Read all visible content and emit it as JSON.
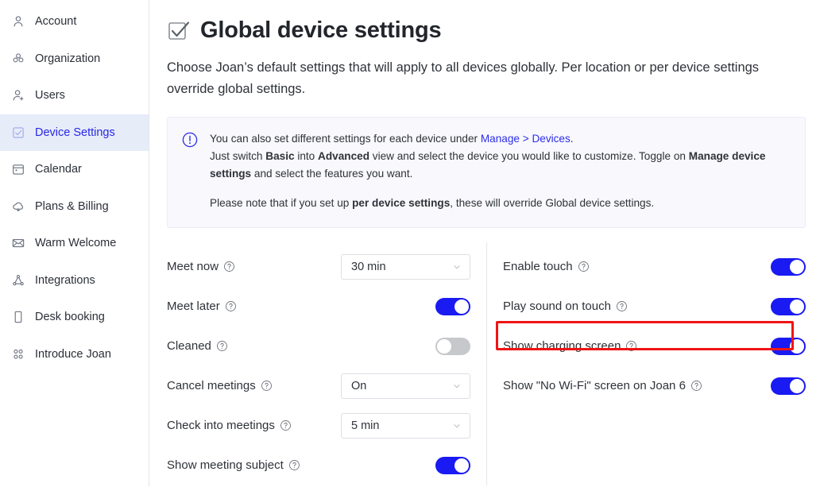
{
  "sidebar": {
    "items": [
      {
        "label": "Account",
        "icon": "user-icon",
        "active": false
      },
      {
        "label": "Organization",
        "icon": "organization-icon",
        "active": false
      },
      {
        "label": "Users",
        "icon": "user-plus-icon",
        "active": false
      },
      {
        "label": "Device Settings",
        "icon": "checkbox-icon",
        "active": true
      },
      {
        "label": "Calendar",
        "icon": "calendar-icon",
        "active": false
      },
      {
        "label": "Plans & Billing",
        "icon": "cloud-icon",
        "active": false
      },
      {
        "label": "Warm Welcome",
        "icon": "envelope-icon",
        "active": false
      },
      {
        "label": "Integrations",
        "icon": "network-icon",
        "active": false
      },
      {
        "label": "Desk booking",
        "icon": "tablet-icon",
        "active": false
      },
      {
        "label": "Introduce Joan",
        "icon": "people-grid-icon",
        "active": false
      }
    ]
  },
  "page": {
    "title": "Global device settings",
    "title_icon": "checkbox-checked-icon",
    "description": "Choose Joan’s default settings that will apply to all devices globally. Per location or per device settings override global settings."
  },
  "banner": {
    "icon": "info-circle-icon",
    "line1_pre": "You can also set different settings for each device under ",
    "line1_link": "Manage > Devices",
    "line1_post": ".",
    "line2_a": "Just switch ",
    "line2_b_basic": "Basic",
    "line2_c": " into ",
    "line2_d_advanced": "Advanced",
    "line2_e": " view and select the device you would like to customize. Toggle on ",
    "line2_f_manage": "Manage device settings",
    "line2_g": " and select the features you want.",
    "line3_a": "Please note that if you set up ",
    "line3_b_perdevice": "per device settings",
    "line3_c": ", these will override Global device settings."
  },
  "settings": {
    "left_column": [
      {
        "label": "Meet now",
        "help": "help-icon",
        "control": "select",
        "value": "30 min"
      },
      {
        "label": "Meet later",
        "help": "help-icon",
        "control": "toggle",
        "value": "on"
      },
      {
        "label": "Cleaned",
        "help": "help-icon",
        "control": "toggle",
        "value": "off"
      },
      {
        "label": "Cancel meetings",
        "help": "help-icon",
        "control": "select",
        "value": "On"
      },
      {
        "label": "Check into meetings",
        "help": "help-icon",
        "control": "select",
        "value": "5 min"
      },
      {
        "label": "Show meeting subject",
        "help": "help-icon",
        "control": "toggle",
        "value": "on"
      }
    ],
    "right_column": [
      {
        "label": "Enable touch",
        "help": "help-icon",
        "control": "toggle",
        "value": "on",
        "highlighted": false
      },
      {
        "label": "Play sound on touch",
        "help": "help-icon",
        "control": "toggle",
        "value": "on",
        "highlighted": false
      },
      {
        "label": "Show charging screen",
        "help": "help-icon",
        "control": "toggle",
        "value": "on",
        "highlighted": true
      },
      {
        "label": "Show \"No Wi-Fi\" screen on Joan 6",
        "help": "help-icon",
        "control": "toggle",
        "value": "on",
        "highlighted": false
      }
    ]
  },
  "colors": {
    "accent_blue": "#1a1af2",
    "link_blue": "#2d2de8",
    "active_nav_bg": "#e7ecf9",
    "active_nav_text": "#2727e6",
    "toggle_off": "#c6c8cc",
    "highlight_red": "#f01414",
    "banner_bg": "#f8f8fd"
  }
}
